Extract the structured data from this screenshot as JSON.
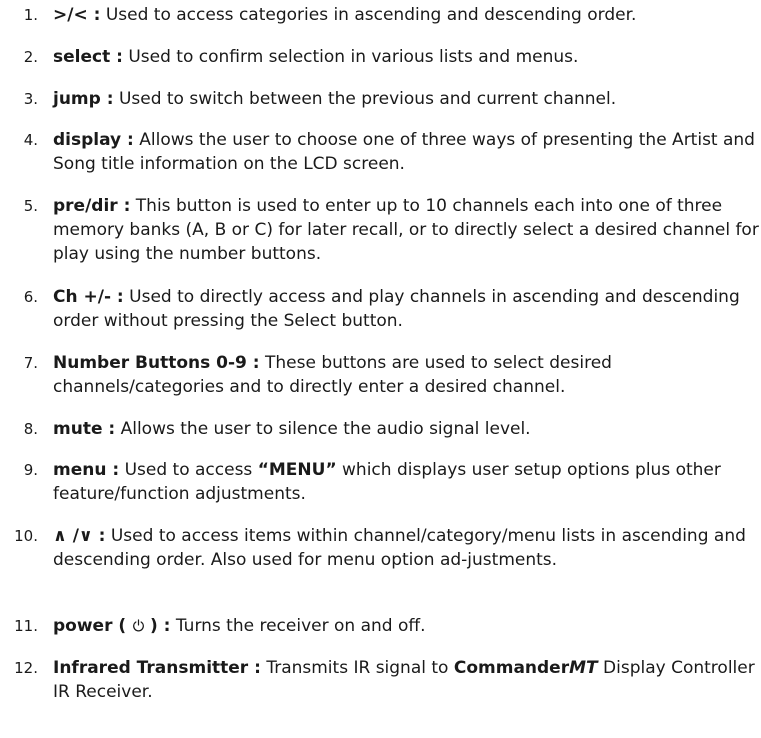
{
  "items": [
    {
      "n": "1.",
      "term": ">/< :",
      "text": "Used to access categories in ascending and descending order."
    },
    {
      "n": "2.",
      "term": "select :",
      "text": "Used to confirm selection in various lists and menus."
    },
    {
      "n": "3.",
      "term": "jump :",
      "text": "Used to switch between the previous and current channel."
    },
    {
      "n": "4.",
      "term": "display :",
      "text": "Allows the user to choose one of  three  ways of presenting the  Artist and Song title information on the LCD screen."
    },
    {
      "n": "5.",
      "term": "pre/dir :",
      "text": "This button is used to enter up to 10 channels each into one of three memory banks (A, B or C) for later recall, or to directly select a desired channel for play using the number buttons."
    },
    {
      "n": "6.",
      "term": "Ch +/- :",
      "text": "Used to directly access and play channels in ascending and descending order without pressing the Select button."
    },
    {
      "n": "7.",
      "term": "Number Buttons 0-9 :",
      "text": "These buttons are used to select desired channels/categories and to directly enter a desired channel."
    },
    {
      "n": "8.",
      "term": "mute :",
      "text": "Allows the user to silence the audio signal level."
    },
    {
      "n": "9.",
      "term": "menu :",
      "text_before": "Used to access",
      "quoted": "“MENU”",
      "text_after": "which displays user setup options plus other feature/function adjustments."
    },
    {
      "n": "10.",
      "term": "∧ /∨ :",
      "text": "Used to access items within channel/category/menu lists in ascending and descending order.  Also used for menu option ad-justments."
    },
    {
      "n": "11.",
      "term_before": "power (",
      "term_after": ") :",
      "text": "Turns the receiver on and off."
    },
    {
      "n": "12.",
      "term": "Infrared Transmitter :",
      "text_before": "Transmits IR signal to",
      "brand_a": "Commander",
      "brand_b": "MT",
      "text_after": "Display Controller IR Receiver."
    }
  ],
  "icons": {
    "power": "power-icon"
  }
}
